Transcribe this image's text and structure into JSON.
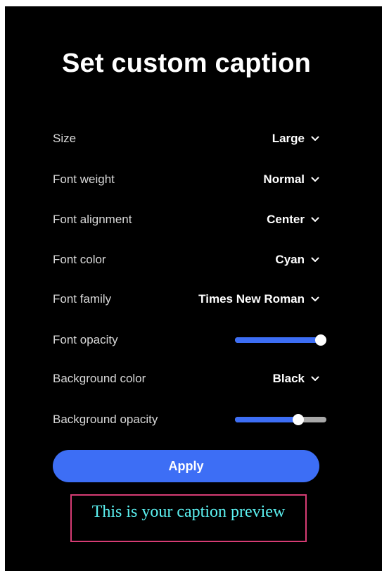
{
  "dialog": {
    "title": "Set custom caption"
  },
  "settings": {
    "size": {
      "label": "Size",
      "value": "Large"
    },
    "font_weight": {
      "label": "Font weight",
      "value": "Normal"
    },
    "font_alignment": {
      "label": "Font alignment",
      "value": "Center"
    },
    "font_color": {
      "label": "Font color",
      "value": "Cyan"
    },
    "font_family": {
      "label": "Font family",
      "value": "Times New Roman"
    },
    "font_opacity": {
      "label": "Font opacity",
      "level_percent": 100
    },
    "background_color": {
      "label": "Background color",
      "value": "Black"
    },
    "background_opacity": {
      "label": "Background opacity",
      "level_percent": 72
    }
  },
  "apply_label": "Apply",
  "preview": {
    "text": "This is your caption preview"
  },
  "colors": {
    "panel_background": "#000000",
    "accent": "#3d6ef5",
    "slider_track": "#a8a8a8",
    "preview_border": "#d63c74",
    "preview_text": "#5cf2f2"
  },
  "icons": {
    "dropdown": "chevron-down-icon",
    "slider_handle": "slider-thumb"
  }
}
